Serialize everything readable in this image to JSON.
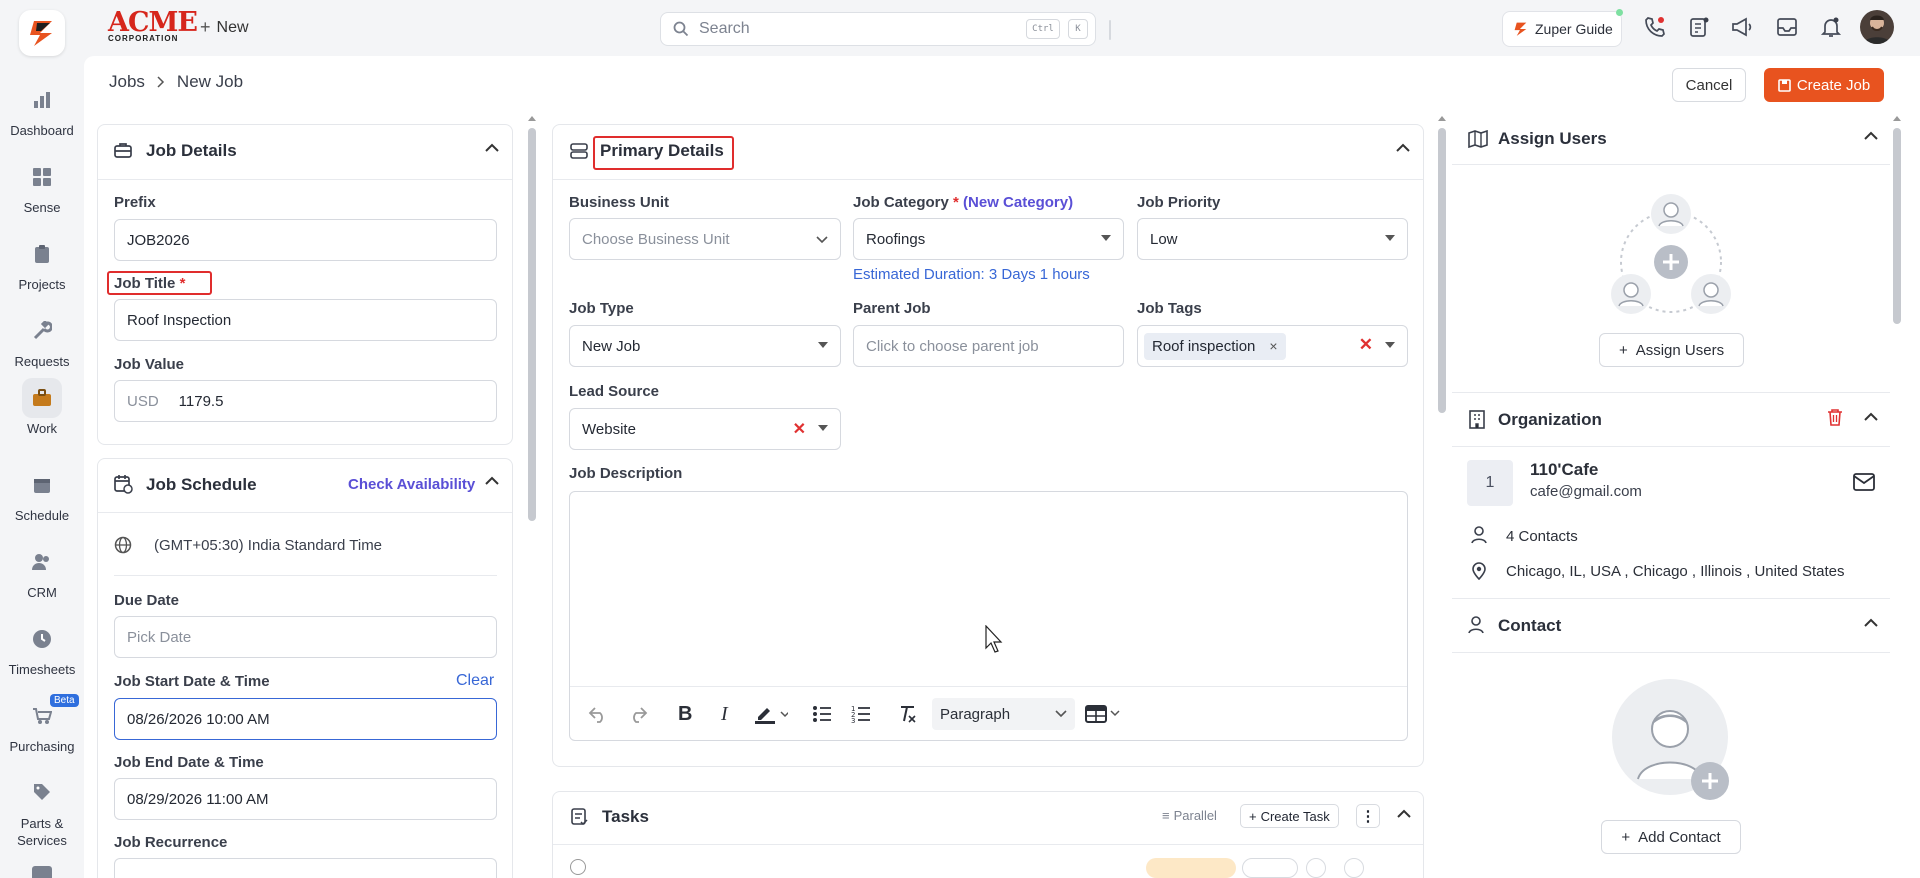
{
  "nav": {
    "items": [
      {
        "label": "Dashboard",
        "icon": "bar-chart-icon"
      },
      {
        "label": "Sense",
        "icon": "grid-icon"
      },
      {
        "label": "Projects",
        "icon": "clipboard-icon"
      },
      {
        "label": "Requests",
        "icon": "wrench-icon"
      },
      {
        "label": "Work",
        "icon": "briefcase-icon"
      },
      {
        "label": "Schedule",
        "icon": "calendar-icon"
      },
      {
        "label": "CRM",
        "icon": "people-icon"
      },
      {
        "label": "Timesheets",
        "icon": "clock-icon"
      },
      {
        "label": "Purchasing",
        "icon": "cart-icon",
        "badge": "Beta"
      },
      {
        "label": "Parts & Services",
        "icon": "tag-icon"
      }
    ]
  },
  "brand": {
    "name": "ACME",
    "sub": "CORPORATION"
  },
  "topbar": {
    "new_label": "New",
    "search_placeholder": "Search",
    "kbd1": "Ctrl",
    "kbd2": "K",
    "guide_label": "Zuper Guide"
  },
  "breadcrumb": {
    "root": "Jobs",
    "current": "New Job"
  },
  "actions": {
    "cancel": "Cancel",
    "create": "Create Job"
  },
  "job_details": {
    "title": "Job Details",
    "prefix_label": "Prefix",
    "prefix_value": "JOB2026",
    "title_label": "Job Title",
    "title_value": "Roof Inspection",
    "value_label": "Job Value",
    "currency": "USD",
    "value": "1179.5"
  },
  "schedule": {
    "title": "Job Schedule",
    "check": "Check Availability",
    "timezone": "(GMT+05:30) India Standard Time",
    "due_label": "Due Date",
    "due_placeholder": "Pick Date",
    "start_label": "Job Start Date & Time",
    "clear": "Clear",
    "start_value": "08/26/2026 10:00 AM",
    "end_label": "Job End Date & Time",
    "end_value": "08/29/2026 11:00 AM",
    "recurrence_label": "Job Recurrence"
  },
  "primary": {
    "title": "Primary Details",
    "bu_label": "Business Unit",
    "bu_placeholder": "Choose Business Unit",
    "cat_label": "Job Category",
    "cat_new": "(New Category)",
    "cat_value": "Roofings",
    "duration": "Estimated Duration: 3 Days 1 hours",
    "priority_label": "Job Priority",
    "priority_value": "Low",
    "type_label": "Job Type",
    "type_value": "New Job",
    "parent_label": "Parent Job",
    "parent_placeholder": "Click to choose parent job",
    "tags_label": "Job Tags",
    "tag": "Roof inspection",
    "lead_label": "Lead Source",
    "lead_value": "Website",
    "desc_label": "Job Description",
    "paragraph": "Paragraph"
  },
  "tasks": {
    "title": "Tasks",
    "parallel": "Parallel",
    "create": "Create Task"
  },
  "assign": {
    "title": "Assign Users",
    "button": "Assign Users"
  },
  "org": {
    "title": "Organization",
    "index": "1",
    "name": "110'Cafe",
    "email": "cafe@gmail.com",
    "contacts": "4 Contacts",
    "address": "Chicago, IL, USA , Chicago , Illinois , United States"
  },
  "contact": {
    "title": "Contact",
    "button": "Add Contact"
  },
  "colors": {
    "accent": "#e8531f",
    "link": "#5a4fd6",
    "required": "#e02d2d",
    "focus": "#3867d6"
  }
}
